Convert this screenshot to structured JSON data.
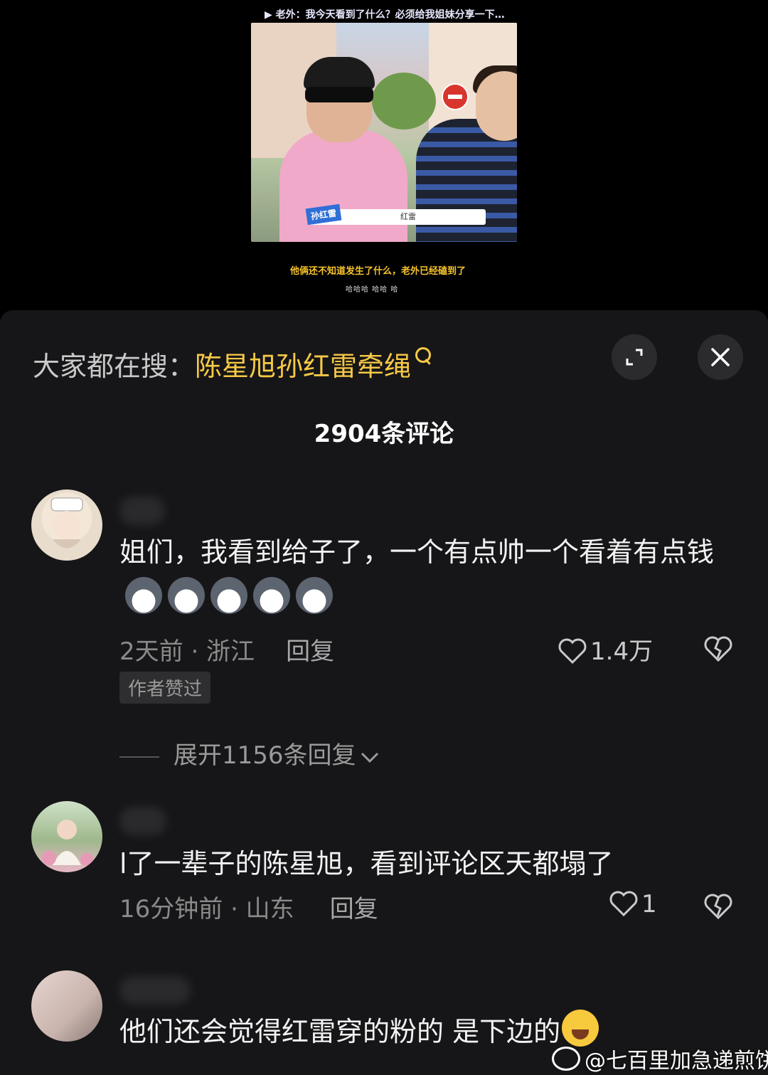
{
  "video": {
    "top_caption": "▶ 老外：我今天看到了什么？必须给我姐妹分享一下…",
    "name_tag": "孙红雷",
    "name_bar_text": "红雷",
    "bottom_caption": "他俩还不知道发生了什么，老外已经磕到了",
    "tiny_caption": "哈哈哈  哈哈  哈"
  },
  "search": {
    "prefix": "大家都在搜：",
    "term": "陈星旭孙红雷牵绳"
  },
  "comment_count": "2904条评论",
  "comments": [
    {
      "text": "姐们，我看到给子了，一个有点帅一个看着有点钱",
      "meta": "2天前 · 浙江",
      "reply": "回复",
      "likes": "1.4万",
      "badge": "作者赞过",
      "expand": "展开1156条回复"
    },
    {
      "text": "l了一辈子的陈星旭，看到评论区天都塌了",
      "meta": "16分钟前 · 山东",
      "reply": "回复",
      "likes": "1"
    },
    {
      "text": "他们还会觉得红雷穿的粉的 是下边的"
    }
  ],
  "watermark": "@七百里加急递煎饼",
  "colors": {
    "accent": "#f7c946",
    "sheet_bg": "#161618",
    "text": "#f2f2f2",
    "meta": "#8a8a8a"
  },
  "icons": [
    "search-icon",
    "expand-icon",
    "close-icon",
    "heart-icon",
    "broken-heart-icon",
    "chevron-down-icon",
    "weibo-icon"
  ]
}
